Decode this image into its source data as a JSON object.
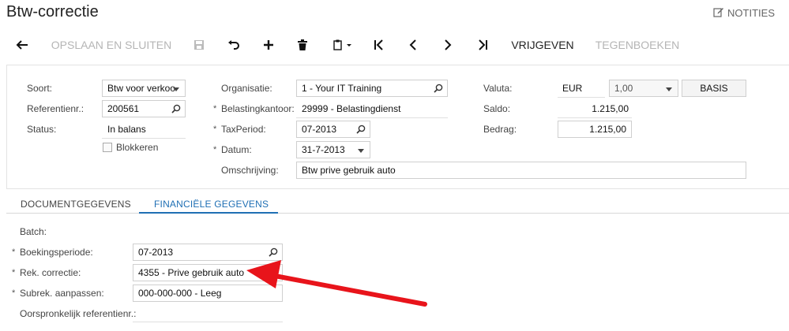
{
  "page": {
    "title": "Btw-correctie",
    "notes_label": "NOTITIES"
  },
  "toolbar": {
    "save_close": "OPSLAAN EN SLUITEN",
    "release": "VRIJGEVEN",
    "reverse": "TEGENBOEKEN"
  },
  "header": {
    "soort": {
      "label": "Soort:",
      "value": "Btw voor verkoo"
    },
    "referentie": {
      "label": "Referentienr.:",
      "value": "200561"
    },
    "status": {
      "label": "Status:",
      "value": "In balans"
    },
    "blokkeren": {
      "label": "Blokkeren",
      "checked": false
    },
    "organisatie": {
      "label": "Organisatie:",
      "value": "1 - Your IT Training"
    },
    "belastingkantoor": {
      "label": "Belastingkantoor:",
      "value": "29999 - Belastingdienst"
    },
    "taxperiod": {
      "label": "TaxPeriod:",
      "value": "07-2013"
    },
    "datum": {
      "label": "Datum:",
      "value": "31-7-2013"
    },
    "omschrijving": {
      "label": "Omschrijving:",
      "value": "Btw prive gebruik auto"
    },
    "valuta": {
      "label": "Valuta:",
      "currency": "EUR",
      "rate": "1,00",
      "basis_button": "BASIS"
    },
    "saldo": {
      "label": "Saldo:",
      "value": "1.215,00"
    },
    "bedrag": {
      "label": "Bedrag:",
      "value": "1.215,00"
    },
    "required_mark": "*"
  },
  "tabs": [
    {
      "label": "DOCUMENTGEGEVENS",
      "active": false
    },
    {
      "label": "FINANCIËLE GEGEVENS",
      "active": true
    }
  ],
  "financial": {
    "batch": {
      "label": "Batch:",
      "value": ""
    },
    "boekingsperiode": {
      "label": "Boekingsperiode:",
      "value": "07-2013"
    },
    "rek_correctie": {
      "label": "Rek. correctie:",
      "value": "4355 - Prive gebruik auto"
    },
    "subrek": {
      "label": "Subrek. aanpassen:",
      "value": "000-000-000 - Leeg"
    },
    "oorspronkelijk": {
      "label": "Oorspronkelijk referentienr.:",
      "value": ""
    }
  },
  "colors": {
    "accent": "#1f6fb4",
    "annotation_arrow": "#e8141b",
    "disabled": "#b5b5b5"
  }
}
